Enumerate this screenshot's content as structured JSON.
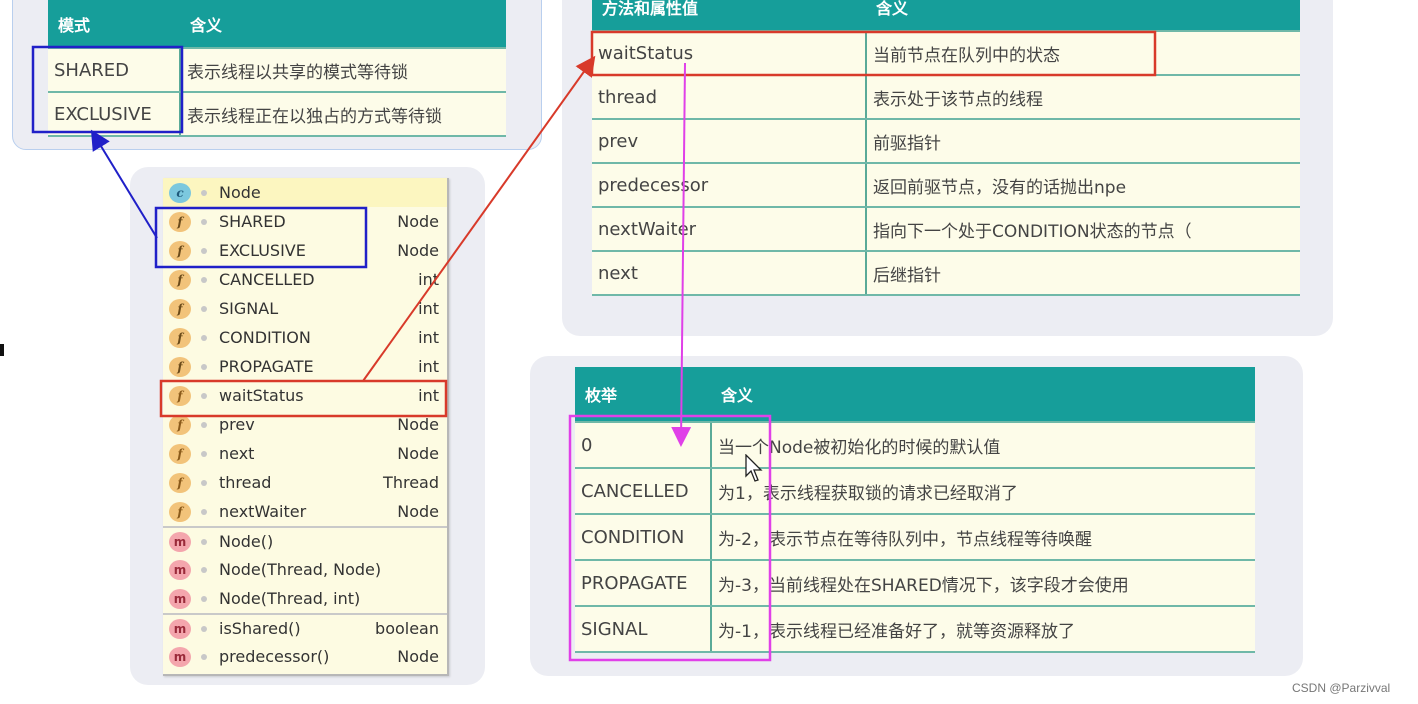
{
  "colors": {
    "header_teal": "#169e9a",
    "cell_bg": "#fdfce9",
    "highlight_blue": "#2020c8",
    "highlight_red": "#d83a2a",
    "highlight_magenta": "#e040e8"
  },
  "mode_table": {
    "headers": [
      "模式",
      "含义"
    ],
    "rows": [
      [
        "SHARED",
        "表示线程以共享的模式等待锁"
      ],
      [
        "EXCLUSIVE",
        "表示线程正在以独占的方式等待锁"
      ]
    ]
  },
  "methods_table": {
    "headers": [
      "方法和属性值",
      "含义"
    ],
    "rows": [
      [
        "waitStatus",
        "当前节点在队列中的状态"
      ],
      [
        "thread",
        "表示处于该节点的线程"
      ],
      [
        "prev",
        "前驱指针"
      ],
      [
        "predecessor",
        "返回前驱节点，没有的话抛出npe"
      ],
      [
        "nextWaiter",
        "指向下一个处于CONDITION状态的节点（"
      ],
      [
        "next",
        "后继指针"
      ]
    ]
  },
  "enum_table": {
    "headers": [
      "枚举",
      "含义"
    ],
    "rows": [
      [
        "0",
        "当一个Node被初始化的时候的默认值"
      ],
      [
        "CANCELLED",
        "为1，表示线程获取锁的请求已经取消了"
      ],
      [
        "CONDITION",
        "为-2，表示节点在等待队列中，节点线程等待唤醒"
      ],
      [
        "PROPAGATE",
        "为-3，当前线程处在SHARED情况下，该字段才会使用"
      ],
      [
        "SIGNAL",
        "为-1，表示线程已经准备好了，就等资源释放了"
      ]
    ]
  },
  "structure": {
    "class_name": "Node",
    "class_icon": "c",
    "members": [
      {
        "icon": "sf",
        "glyph": "f",
        "name": "SHARED",
        "type": "Node"
      },
      {
        "icon": "sf",
        "glyph": "f",
        "name": "EXCLUSIVE",
        "type": "Node"
      },
      {
        "icon": "sf",
        "glyph": "f",
        "name": "CANCELLED",
        "type": "int"
      },
      {
        "icon": "sf",
        "glyph": "f",
        "name": "SIGNAL",
        "type": "int"
      },
      {
        "icon": "sf",
        "glyph": "f",
        "name": "CONDITION",
        "type": "int"
      },
      {
        "icon": "sf",
        "glyph": "f",
        "name": "PROPAGATE",
        "type": "int"
      },
      {
        "icon": "f",
        "glyph": "f",
        "name": "waitStatus",
        "type": "int"
      },
      {
        "icon": "f",
        "glyph": "f",
        "name": "prev",
        "type": "Node"
      },
      {
        "icon": "f",
        "glyph": "f",
        "name": "next",
        "type": "Node"
      },
      {
        "icon": "f",
        "glyph": "f",
        "name": "thread",
        "type": "Thread"
      },
      {
        "icon": "f",
        "glyph": "f",
        "name": "nextWaiter",
        "type": "Node"
      },
      {
        "icon": "m",
        "glyph": "m",
        "name": "Node()",
        "type": "",
        "sep": true
      },
      {
        "icon": "m",
        "glyph": "m",
        "name": "Node(Thread, Node)",
        "type": ""
      },
      {
        "icon": "m",
        "glyph": "m",
        "name": "Node(Thread, int)",
        "type": ""
      },
      {
        "icon": "am",
        "glyph": "m",
        "name": "isShared()",
        "type": "boolean",
        "sep": true
      },
      {
        "icon": "am",
        "glyph": "m",
        "name": "predecessor()",
        "type": "Node"
      }
    ]
  },
  "watermark": "CSDN @Parzivval"
}
